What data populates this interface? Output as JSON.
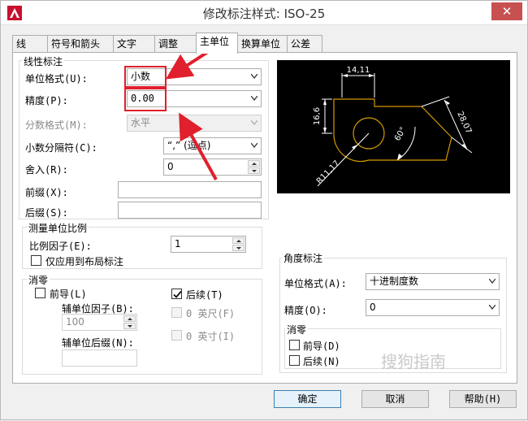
{
  "window": {
    "title": "修改标注样式: ISO-25",
    "close": "✕"
  },
  "tabs": [
    "线",
    "符号和箭头",
    "文字",
    "调整",
    "主单位",
    "换算单位",
    "公差"
  ],
  "linear": {
    "group": "线性标注",
    "unit_format_label": "单位格式(U):",
    "unit_format_value": "小数",
    "precision_label": "精度(P):",
    "precision_value": "0.00",
    "fraction_label": "分数格式(M):",
    "fraction_value": "水平",
    "decimal_sep_label": "小数分隔符(C):",
    "decimal_sep_value": "“,”  (逗点)",
    "round_label": "舍入(R):",
    "round_value": "0",
    "prefix_label": "前缀(X):",
    "suffix_label": "后缀(S):"
  },
  "scale": {
    "group": "测量单位比例",
    "factor_label": "比例因子(E):",
    "factor_value": "1",
    "layout_only": "仅应用到布局标注"
  },
  "zero": {
    "group": "消零",
    "leading": "前导(L)",
    "trailing": "后续(T)",
    "sub_factor_label": "辅单位因子(B):",
    "sub_factor_value": "100",
    "feet": "0 英尺(F)",
    "sub_suffix_label": "辅单位后缀(N):",
    "inches": "0 英寸(I)"
  },
  "angular": {
    "group": "角度标注",
    "unit_format_label": "单位格式(A):",
    "unit_format_value": "十进制度数",
    "precision_label": "精度(O):",
    "precision_value": "0",
    "zero_group": "消零",
    "leading": "前导(D)",
    "trailing": "后续(N)"
  },
  "preview": {
    "dim_top": "14,11",
    "dim_left": "16,6",
    "dim_right": "28,07",
    "dim_angle": "60°",
    "dim_radius": "R11,17"
  },
  "buttons": {
    "ok": "确定",
    "cancel": "取消",
    "help": "帮助(H)"
  },
  "watermark": "搜狗指南",
  "colors": {
    "highlight": "#e0202c",
    "dimension": "#ffffff",
    "geometry": "#d59a00"
  }
}
